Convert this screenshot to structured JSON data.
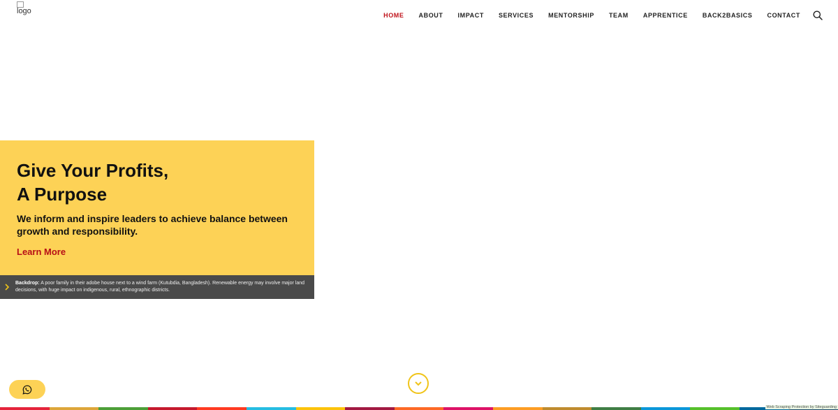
{
  "header": {
    "logo_alt": "logo",
    "nav": [
      "HOME",
      "ABOUT",
      "IMPACT",
      "SERVICES",
      "MENTORSHIP",
      "TEAM",
      "APPRENTICE",
      "BACK2BASICS",
      "CONTACT"
    ],
    "active": "HOME",
    "search_icon": "search-icon"
  },
  "hero": {
    "title_line1": "Give Your Profits,",
    "title_line2": "A Purpose",
    "subtitle": "We inform and inspire leaders to achieve balance between growth and responsibility.",
    "cta": "Learn More"
  },
  "caption": {
    "label": "Backdrop:",
    "text": "A poor family in their adobe house next to a wind farm (Kutubdia, Bangladesh). Renewable energy may involve major land decisions, with huge impact on indigenous, rural, ethnographic districts."
  },
  "footer": {
    "protection_text": "Web Scraping Protection by Siteguarding"
  },
  "colors": {
    "accent_yellow": "#fdd256",
    "accent_red": "#c0131b",
    "caption_bg": "#4a4a4a",
    "stripe": [
      "#e5243b",
      "#dda63a",
      "#4c9f38",
      "#c5192d",
      "#ff3a21",
      "#26bde2",
      "#fcc30b",
      "#a21942",
      "#fd6925",
      "#dd1367",
      "#fd9d24",
      "#bf8b2e",
      "#3f7e44",
      "#0a97d9",
      "#56c02b",
      "#00689d",
      "#19486a"
    ]
  },
  "icons": {
    "caption_toggle": "chevron-right-icon",
    "scroll": "chevron-down-circle-icon",
    "whatsapp": "whatsapp-icon"
  }
}
